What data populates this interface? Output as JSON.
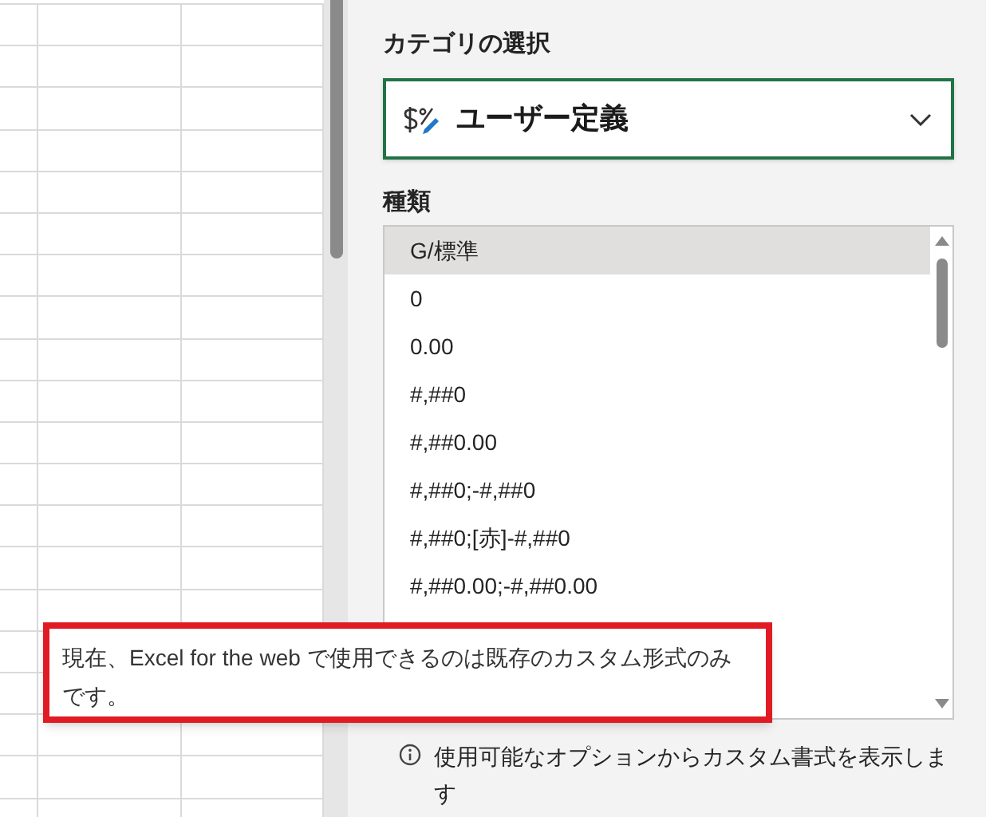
{
  "category": {
    "label": "カテゴリの選択",
    "value": "ユーザー定義"
  },
  "format_list": {
    "label": "種類",
    "items": [
      {
        "text": "G/標準",
        "selected": true
      },
      {
        "text": "0",
        "selected": false
      },
      {
        "text": "0.00",
        "selected": false
      },
      {
        "text": "#,##0",
        "selected": false
      },
      {
        "text": "#,##0.00",
        "selected": false
      },
      {
        "text": "#,##0;-#,##0",
        "selected": false
      },
      {
        "text": "#,##0;[赤]-#,##0",
        "selected": false
      },
      {
        "text": "#,##0.00;-#,##0.00",
        "selected": false
      }
    ]
  },
  "info": "使用可能なオプションからカスタム書式を表示します",
  "tooltip": "現在、Excel for the web で使用できるのは既存のカスタム形式のみです。"
}
